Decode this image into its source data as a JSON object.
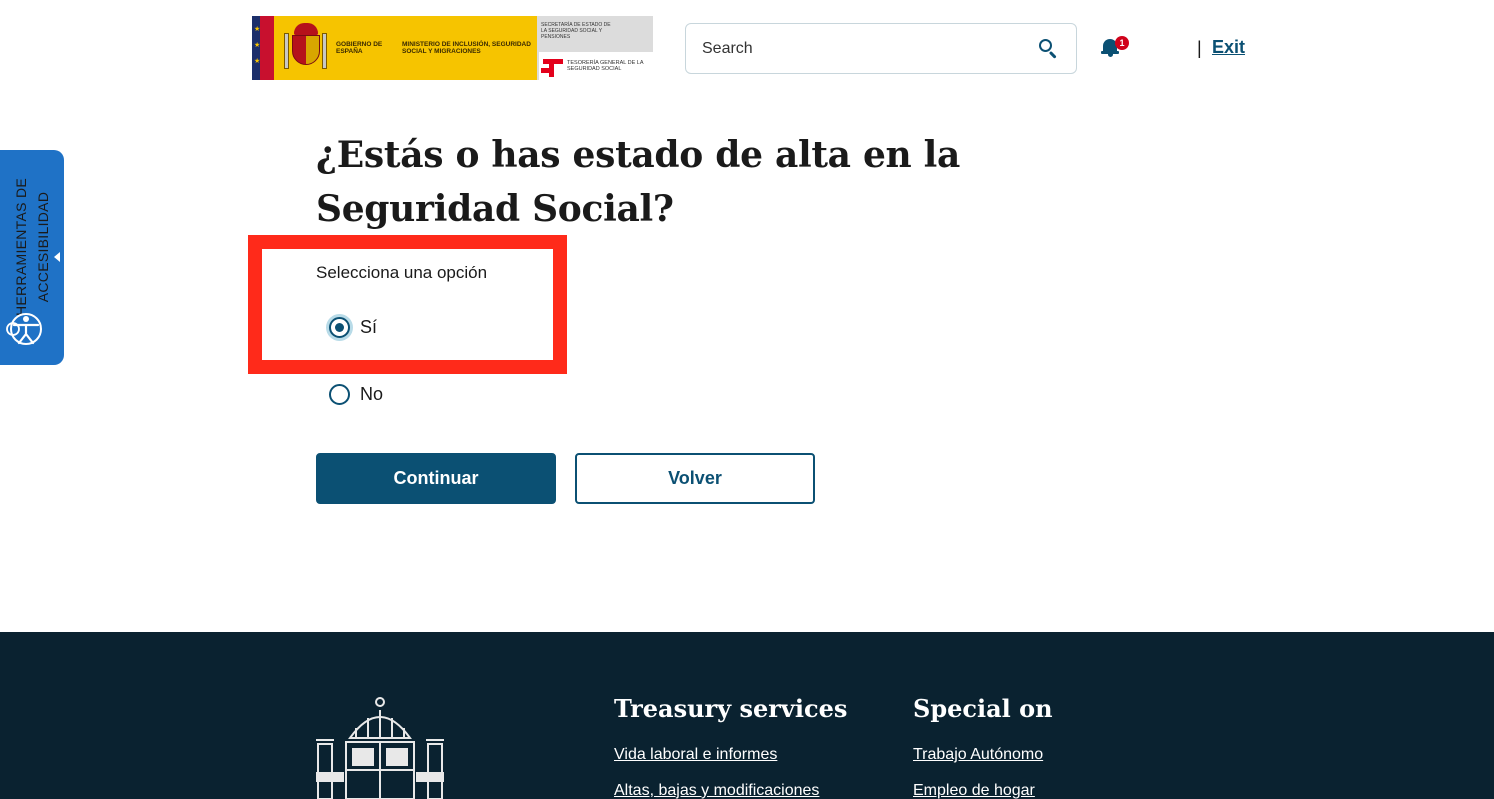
{
  "header": {
    "logo": {
      "gobierno": "GOBIERNO DE ESPAÑA",
      "ministerio": "MINISTERIO DE INCLUSIÓN, SEGURIDAD SOCIAL Y MIGRACIONES",
      "secretaria": "SECRETARÍA DE ESTADO DE LA SEGURIDAD SOCIAL Y PENSIONES",
      "tesoreria": "TESORERÍA GENERAL DE LA SEGURIDAD SOCIAL"
    },
    "search": {
      "placeholder": "Search"
    },
    "notifications_count": "1",
    "separator": "|",
    "exit_label": "Exit"
  },
  "accessibility_tab": {
    "line1": "HERRAMIENTAS DE",
    "line2": "ACCESIBILIDAD"
  },
  "main": {
    "question": "¿Estás o has estado de alta en la Seguridad Social?",
    "legend": "Selecciona una opción",
    "options": [
      {
        "label": "Sí",
        "checked": true
      },
      {
        "label": "No",
        "checked": false
      }
    ],
    "continue_label": "Continuar",
    "back_label": "Volver"
  },
  "footer": {
    "col1": {
      "title": "Treasury services",
      "links": [
        "Vida laboral e informes",
        "Altas, bajas y modificaciones"
      ]
    },
    "col2": {
      "title": "Special on",
      "links": [
        "Trabajo Autónomo",
        "Empleo de hogar"
      ]
    }
  },
  "colors": {
    "primary": "#0b5073",
    "highlight": "#ff2a1a",
    "footer_bg": "#0a2230",
    "accessibility_tab": "#1f72c6"
  }
}
